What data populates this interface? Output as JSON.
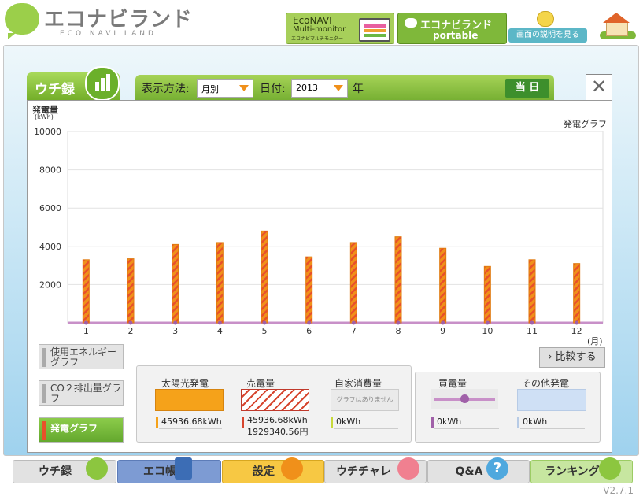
{
  "header": {
    "logo_text": "エコナビランド",
    "logo_sub": "ECO NAVI LAND",
    "econavi_title": "EcoNAVI",
    "econavi_sub": "Multi-monitor",
    "econavi_small": "エコナビマルチモニター",
    "portable_title": "エコナビランド",
    "portable_sub": "portable",
    "help": "画面の説明を見る"
  },
  "tab": {
    "label": "ウチ録"
  },
  "toolbar": {
    "method_label": "表示方法:",
    "method_value": "月別",
    "date_label": "日付:",
    "date_value": "2013",
    "year_suffix": "年",
    "today": "当 日"
  },
  "chart_data": {
    "type": "bar",
    "title": "発電グラフ",
    "ylabel": "発電量",
    "yunit": "(kWh)",
    "xunit": "(月)",
    "categories": [
      "1",
      "2",
      "3",
      "4",
      "5",
      "6",
      "7",
      "8",
      "9",
      "10",
      "11",
      "12"
    ],
    "values": [
      3300,
      3350,
      4100,
      4200,
      4800,
      3450,
      4200,
      4500,
      3900,
      2950,
      3300,
      3100
    ],
    "ylim": [
      0,
      10000
    ],
    "yticks": [
      "10000",
      "8000",
      "6000",
      "4000",
      "2000"
    ],
    "grid": true,
    "bar_color": "#f0901a",
    "stripe_color": "#e8502a",
    "baseline_color": "#c890c8"
  },
  "side": {
    "energy": "使用エネルギーグラフ",
    "co2": "CO２排出量グラフ",
    "gen": "発電グラフ"
  },
  "compare": "比較する",
  "legend": {
    "solar": {
      "title": "太陽光発電",
      "value": "45936.68kWh",
      "color": "#f5a21a"
    },
    "sell": {
      "title": "売電量",
      "value": "45936.68kWh",
      "value2": "1929340.56円"
    },
    "self": {
      "title": "自家消費量",
      "note": "グラフはありません",
      "value": "0kWh"
    },
    "buy": {
      "title": "買電量",
      "value": "0kWh"
    },
    "other": {
      "title": "その他発電",
      "value": "0kWh"
    }
  },
  "nav": {
    "uchiroku": "ウチ録",
    "ecocho": "エコ帳",
    "settei": "設定",
    "uchichare": "ウチチャレ",
    "qa": "Q&A",
    "ranking": "ランキング"
  },
  "version": "V2.7.1"
}
